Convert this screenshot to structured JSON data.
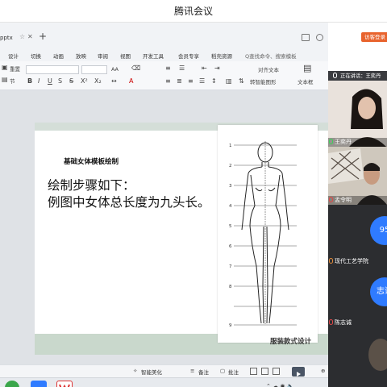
{
  "window": {
    "title": "腾讯会议"
  },
  "editor": {
    "tab_label": "pptx",
    "login_button": "访客登录",
    "menu": [
      "设计",
      "切换",
      "动画",
      "放映",
      "审阅",
      "视图",
      "开发工具",
      "会员专享",
      "稻壳资源"
    ],
    "menu_search": "Q查找命令、搜索模板",
    "ribbon": {
      "paste_label": "重置",
      "section_label": "节",
      "align_label": "对齐文本",
      "smartart_label": "转智能图形",
      "textbox_label": "文本框",
      "text_effect": "ΑΑ"
    },
    "status": {
      "beautify": "智能美化",
      "notes": "备注",
      "comments": "批注"
    }
  },
  "slide": {
    "subtitle": "基础女体模板绘制",
    "body_lines": [
      "绘制步骤如下：",
      "例图中女体总长度为九头长。"
    ],
    "footer": "服装款式设计",
    "ruler_labels": [
      "1",
      "2",
      "3",
      "4",
      "5",
      "6",
      "7",
      "8",
      "9"
    ]
  },
  "meeting": {
    "speaking_label": "正在讲话：王奕丹",
    "participants": [
      {
        "name": "王奕丹",
        "muted": false
      },
      {
        "name": "孟令明",
        "muted": true
      }
    ],
    "bubbles": [
      {
        "text": "95"
      },
      {
        "text": "志诚"
      }
    ],
    "labels": [
      {
        "name": "现代工艺学院"
      },
      {
        "name": "陈志诚"
      }
    ]
  },
  "colors": {
    "accent": "#2f7bff",
    "login": "#e8632d",
    "slide_band": "#c9d8cc"
  }
}
